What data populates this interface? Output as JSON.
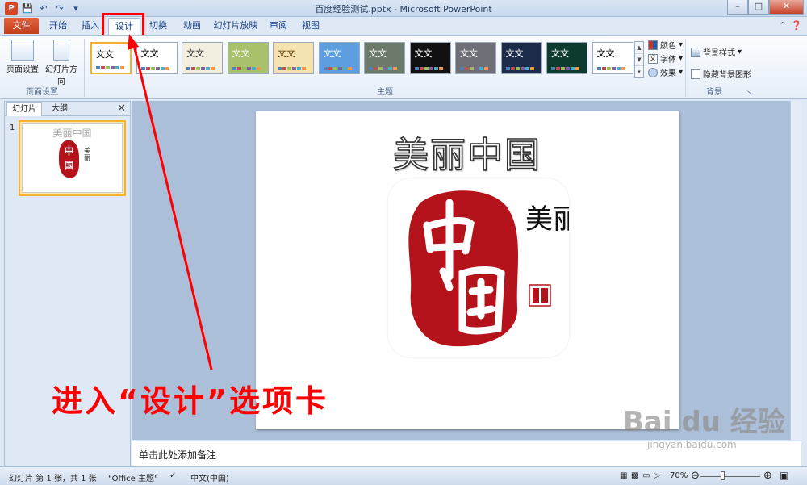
{
  "window": {
    "title": "百度经验测试.pptx - Microsoft PowerPoint",
    "app_icon": "P"
  },
  "ribbon_tabs": {
    "file": "文件",
    "tabs": [
      "开始",
      "插入",
      "设计",
      "切换",
      "动画",
      "幻灯片放映",
      "审阅",
      "视图"
    ],
    "active": "设计"
  },
  "page_setup": {
    "page_setup_label": "页面设置",
    "orientation_label": "幻灯片方向",
    "group_label": "页面设置"
  },
  "themes": {
    "sample_text": "文文",
    "group_label": "主题",
    "items": [
      {
        "bg": "#ffffff",
        "fg": "#000000"
      },
      {
        "bg": "#ffffff",
        "fg": "#000000"
      },
      {
        "bg": "#f2efe0",
        "fg": "#333333"
      },
      {
        "bg": "#a9c16b",
        "fg": "#ffffff"
      },
      {
        "bg": "#f4e3b0",
        "fg": "#5a3a00"
      },
      {
        "bg": "#5d9ee0",
        "fg": "#ffffff"
      },
      {
        "bg": "#6b7a6a",
        "fg": "#ffffff"
      },
      {
        "bg": "#111111",
        "fg": "#ffffff"
      },
      {
        "bg": "#6e6e76",
        "fg": "#ffffff"
      },
      {
        "bg": "#1c2b4a",
        "fg": "#ffffff"
      },
      {
        "bg": "#0d3b30",
        "fg": "#ffffff"
      },
      {
        "bg": "#ffffff",
        "fg": "#000000"
      }
    ]
  },
  "theme_options": {
    "colors": "颜色",
    "fonts": "字体",
    "effects": "效果"
  },
  "background": {
    "styles": "背景样式",
    "hide_graphics": "隐藏背景图形",
    "group_label": "背景"
  },
  "left_panel": {
    "tab_slides": "幻灯片",
    "tab_outline": "大纲",
    "slide_number": "1",
    "thumb_title": "美丽中国"
  },
  "slide": {
    "title": "美丽中国",
    "seal_big": "中国",
    "side_text": "美丽"
  },
  "notes_placeholder": "单击此处添加备注",
  "status": {
    "slide_info": "幻灯片 第 1 张，共 1 张",
    "theme": "\"Office 主题\"",
    "language": "中文(中国)",
    "zoom": "70%"
  },
  "annotation": {
    "text": "进入“设计”选项卡",
    "color": "#ff0000"
  },
  "watermark": {
    "brand": "Bai du 经验",
    "url": "jingyan.baidu.com"
  }
}
